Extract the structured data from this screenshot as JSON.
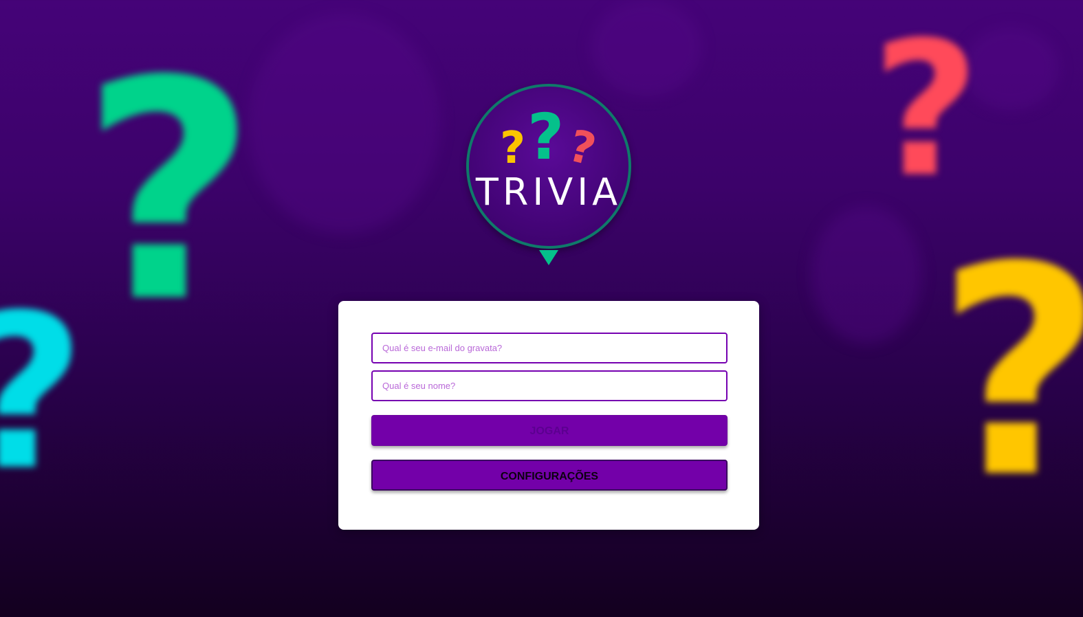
{
  "logo": {
    "title": "TRIVIA",
    "marks": [
      {
        "char": "?",
        "color": "#fbc400"
      },
      {
        "char": "?",
        "color": "#05c18b"
      },
      {
        "char": "?",
        "color": "#f0505a"
      }
    ]
  },
  "background": {
    "marks": [
      {
        "char": "?",
        "color": "#00d38b"
      },
      {
        "char": "?",
        "color": "#00dde8"
      },
      {
        "char": "?",
        "color": "#ff4a5a"
      },
      {
        "char": "?",
        "color": "#ffc600"
      }
    ]
  },
  "login": {
    "email_placeholder": "Qual é seu e-mail do gravata?",
    "name_placeholder": "Qual é seu nome?",
    "play_label": "JOGAR",
    "settings_label": "CONFIGURAÇÕES"
  },
  "colors": {
    "primary": "#7300a9",
    "accent_green": "#05c18b",
    "accent_yellow": "#fbc400",
    "accent_red": "#f0505a"
  }
}
